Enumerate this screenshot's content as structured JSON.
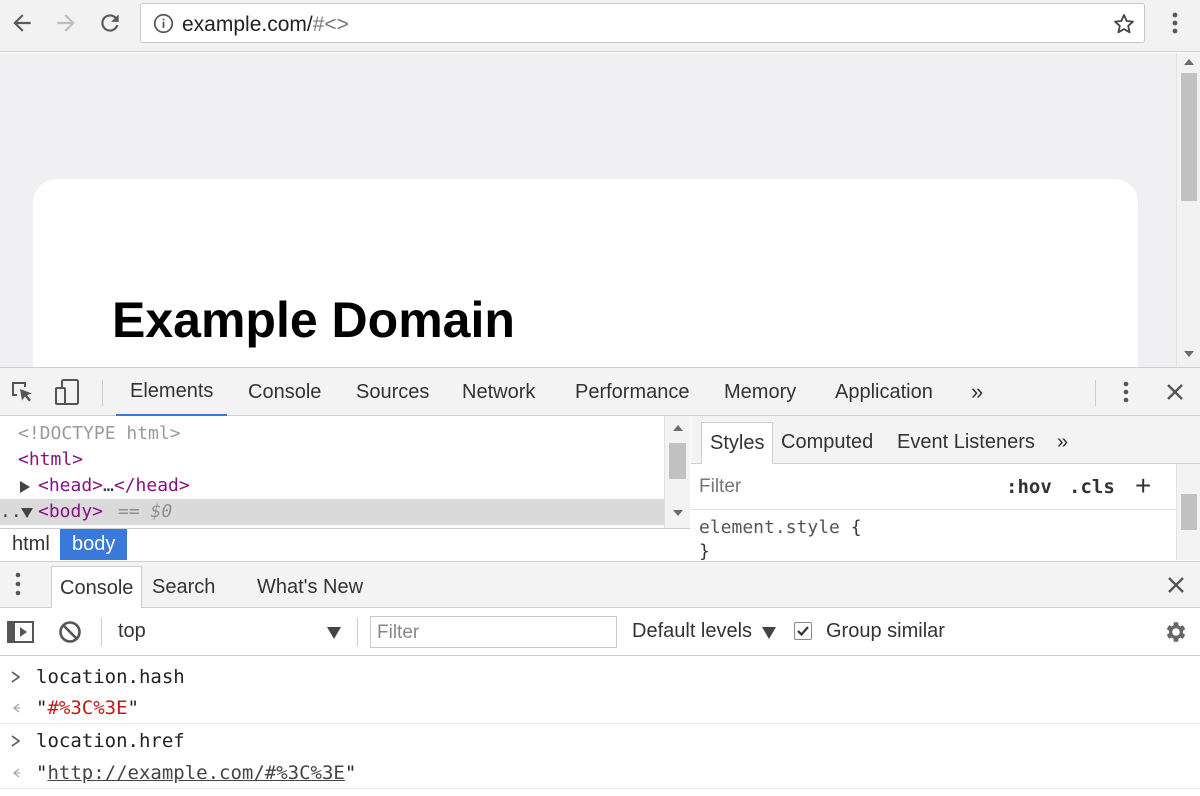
{
  "browser": {
    "url_host": "example.com/",
    "url_rest": "#<>",
    "icons": [
      "back-icon",
      "forward-icon",
      "reload-icon",
      "info-icon",
      "star-icon",
      "menu-icon"
    ]
  },
  "page": {
    "heading": "Example Domain"
  },
  "devtools": {
    "tabs": [
      "Elements",
      "Console",
      "Sources",
      "Network",
      "Performance",
      "Memory",
      "Application"
    ],
    "more": "»",
    "active_tab": "Elements",
    "tree": {
      "doctype": "<!DOCTYPE html>",
      "html_open": "<html>",
      "head_open": "<head>",
      "ellipsis": "…",
      "head_close": "</head>",
      "body_open": "<body>",
      "selected_marker": "== $0",
      "gutter": "..."
    },
    "breadcrumbs": [
      "html",
      "body"
    ],
    "styles": {
      "tabs": [
        "Styles",
        "Computed",
        "Event Listeners"
      ],
      "more": "»",
      "filter_placeholder": "Filter",
      "hov": ":hov",
      "cls": ".cls",
      "add": "+",
      "rule_selector": "element.style",
      "open_brace": "{",
      "close_brace": "}"
    }
  },
  "drawer": {
    "tabs": [
      "Console",
      "Search",
      "What's New"
    ],
    "active_tab": "Console"
  },
  "console_toolbar": {
    "context": "top",
    "filter_placeholder": "Filter",
    "levels": "Default levels",
    "group_similar": "Group similar",
    "group_similar_checked": true
  },
  "console_messages": [
    {
      "kind": "input",
      "text": "location.hash"
    },
    {
      "kind": "result",
      "quote": "\"",
      "value": "#%3C%3E"
    },
    {
      "kind": "input",
      "text": "location.href"
    },
    {
      "kind": "result",
      "quote": "\"",
      "value": "http://example.com/#%3C%3E"
    }
  ]
}
